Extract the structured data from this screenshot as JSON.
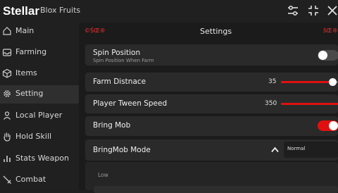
{
  "window": {
    "title": "Stellar",
    "subtitle": "Blox Fruits"
  },
  "titlebar_icons": [
    "sliders-icon",
    "shrink-icon",
    "close-icon"
  ],
  "sidebar": {
    "items": [
      {
        "label": "Main",
        "icon": "home-icon"
      },
      {
        "label": "Farming",
        "icon": "inbox-icon"
      },
      {
        "label": "Items",
        "icon": "box-icon"
      },
      {
        "label": "Setting",
        "icon": "gear-icon",
        "active": true
      },
      {
        "label": "Local Player",
        "icon": "user-icon"
      },
      {
        "label": "Hold Skill",
        "icon": "hand-icon"
      },
      {
        "label": "Stats Weapon",
        "icon": "bar-chart-icon"
      },
      {
        "label": "Combat",
        "icon": "sword-icon"
      }
    ]
  },
  "header": {
    "mark_left": "©ŠŒ®",
    "title": "Settings",
    "mark_right": "šŒ®"
  },
  "settings": {
    "spin_position": {
      "title": "Spin Position",
      "desc": "Spin Position When Farm",
      "enabled": false
    },
    "farm_distance": {
      "title": "Farm Distnace",
      "value": "35",
      "fraction": 0.83
    },
    "tween_speed": {
      "title": "Player Tween Speed",
      "value": "350",
      "fraction": 1.0
    },
    "bring_mob": {
      "title": "Bring Mob",
      "enabled": true
    },
    "bringmob_mode": {
      "title": "BringMob Mode",
      "selected": "Normal",
      "option_label": "Low"
    }
  },
  "colors": {
    "accent": "#e01010",
    "toggle_off": "#4a4a4a",
    "background": "#1b1b1b"
  }
}
